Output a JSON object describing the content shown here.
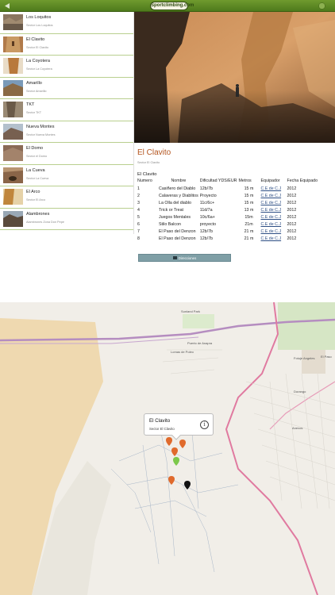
{
  "header": {
    "logo_text": "Sportclimbing.com",
    "back_icon": "back-arrow-icon",
    "menu_icon": "user-icon"
  },
  "sidebar": {
    "items": [
      {
        "title": "Los Loquitos",
        "subtitle": "Sector Los Loquitos"
      },
      {
        "title": "El Clavito",
        "subtitle": "Sector El Clavito"
      },
      {
        "title": "La Coyotera",
        "subtitle": "Sector La Coyotera"
      },
      {
        "title": "Amarillo",
        "subtitle": "Sector Amarillo"
      },
      {
        "title": "TKT",
        "subtitle": "Sector TKT"
      },
      {
        "title": "Nueva Montes",
        "subtitle": "Sector Nueva Montes"
      },
      {
        "title": "El Domo",
        "subtitle": "Sector el Domo"
      },
      {
        "title": "La Cueva",
        "subtitle": "Sector La Cueva"
      },
      {
        "title": "El Arco",
        "subtitle": "Sector El Arco"
      },
      {
        "title": "Alambrones",
        "subtitle": "Alambrones Zona Don Pepe"
      }
    ]
  },
  "detail": {
    "title": "El Clavito",
    "subtitle": "Sector El Clavito",
    "section": "El Clavito",
    "columns": [
      "Numero",
      "Nombre",
      "Dificultad YDS/EUR",
      "Metros",
      "Equipador",
      "Fecha Equipado"
    ],
    "rows": [
      {
        "num": "1",
        "name": "Casiñero del Diablo",
        "grade": "12b/7b",
        "m": "15 m",
        "eq": "C.E de C.J",
        "date": "2012"
      },
      {
        "num": "2",
        "name": "Calaveras y Diablitos",
        "grade": "Proyecto",
        "m": "15 m",
        "eq": "C.E de C.J",
        "date": "2012"
      },
      {
        "num": "3",
        "name": "La Olla del diablo",
        "grade": "11c/6c+",
        "m": "15 m",
        "eq": "C.E de C.J",
        "date": "2012"
      },
      {
        "num": "4",
        "name": "Trick or Treat",
        "grade": "11d/7a",
        "m": "13 m",
        "eq": "C.E de C.J",
        "date": "2012"
      },
      {
        "num": "5",
        "name": "Juegos Mentales",
        "grade": "10c/6a+",
        "m": "15m",
        "eq": "C.E de C.J",
        "date": "2012"
      },
      {
        "num": "6",
        "name": "Stilo Balcon",
        "grade": "proyecto",
        "m": "21m",
        "eq": "C.E de C.J",
        "date": "2012"
      },
      {
        "num": "7",
        "name": "El Paso del Denzon",
        "grade": "12b/7b",
        "m": "21 m",
        "eq": "C.E de C.J",
        "date": "2012"
      },
      {
        "num": "8",
        "name": "El Paso del Denzon",
        "grade": "12b/7b",
        "m": "21 m",
        "eq": "C.E de C.J",
        "date": "2012"
      }
    ],
    "directions_label": "Direcciones"
  },
  "map": {
    "callout_title": "El Clavito",
    "callout_subtitle": "Sector El Clavito",
    "labels": {
      "sunland": "Sunland Park",
      "anapra": "Puerto de Anapra",
      "paso": "El Paso",
      "durango": "Durango",
      "anexos": "Anexos",
      "fotoAngeles": "Fotuje Angeles",
      "lomas": "Lomas de Poleo"
    }
  },
  "colors": {
    "header_green": "#5a8724",
    "title_orange": "#b3541e",
    "link_blue": "#2d4e84",
    "button_teal": "#7f9fa6",
    "route_pink": "#d96a8a"
  }
}
